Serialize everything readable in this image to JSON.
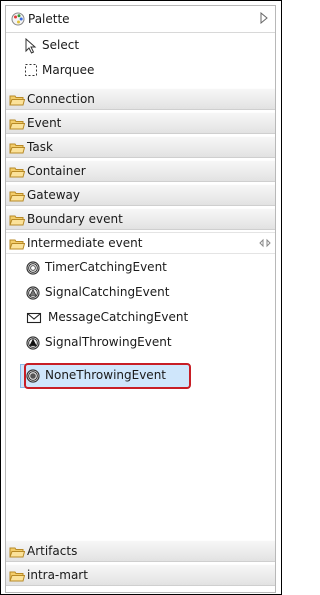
{
  "palette": {
    "title": "Palette",
    "icon": "palette-icon",
    "menu_icon": "triangle-right-icon"
  },
  "tools": [
    {
      "label": "Select",
      "icon": "arrow-pointer-icon"
    },
    {
      "label": "Marquee",
      "icon": "marquee-icon"
    }
  ],
  "drawers_top": [
    {
      "label": "Connection"
    },
    {
      "label": "Event"
    },
    {
      "label": "Task"
    },
    {
      "label": "Container"
    },
    {
      "label": "Gateway"
    },
    {
      "label": "Boundary event"
    }
  ],
  "open_drawer": {
    "label": "Intermediate event",
    "pin_icon": "pin-icon",
    "entries": [
      {
        "label": "TimerCatchingEvent",
        "icon": "timer-event-icon"
      },
      {
        "label": "SignalCatchingEvent",
        "icon": "signal-catching-icon"
      },
      {
        "label": "MessageCatchingEvent",
        "icon": "envelope-icon"
      },
      {
        "label": "SignalThrowingEvent",
        "icon": "signal-throwing-icon"
      },
      {
        "label": "NoneThrowingEvent",
        "icon": "none-throwing-icon",
        "selected": true
      }
    ]
  },
  "drawers_bottom": [
    {
      "label": "Artifacts"
    },
    {
      "label": "intra-mart"
    }
  ],
  "colors": {
    "highlight": "#c81e25",
    "selection": "#cfe6fb",
    "folder": "#e8b94a"
  }
}
